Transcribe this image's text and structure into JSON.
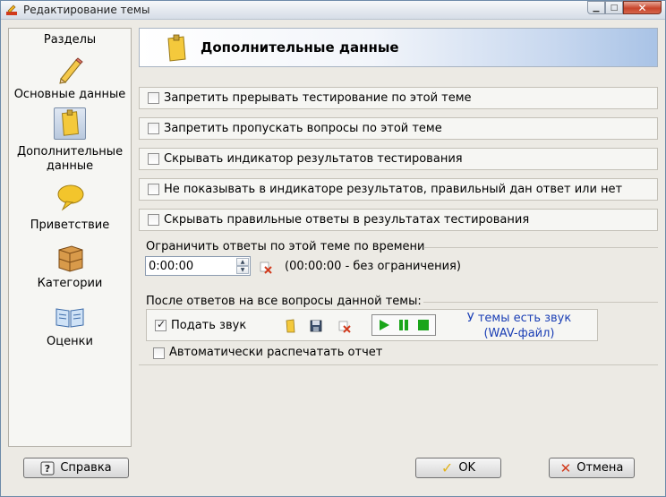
{
  "window": {
    "title": "Редактирование темы",
    "icons": {
      "app": "pencil-icon",
      "minimize": "minimize-icon",
      "maximize": "maximize-icon",
      "close": "close-icon"
    }
  },
  "sidebar": {
    "caption": "Разделы",
    "items": [
      {
        "label": "Основные данные",
        "icon": "pencil-icon",
        "selected": false
      },
      {
        "label": "Дополнительные данные",
        "icon": "sticky-note-icon",
        "selected": true
      },
      {
        "label": "Приветствие",
        "icon": "speech-bubble-icon",
        "selected": false
      },
      {
        "label": "Категории",
        "icon": "cabinet-icon",
        "selected": false
      },
      {
        "label": "Оценки",
        "icon": "book-icon",
        "selected": false
      }
    ]
  },
  "header": {
    "title": "Дополнительные данные",
    "icon": "sticky-note-icon"
  },
  "options": [
    {
      "label": "Запретить прерывать тестирование по этой теме",
      "checked": false
    },
    {
      "label": "Запретить пропускать вопросы по этой теме",
      "checked": false
    },
    {
      "label": "Скрывать индикатор результатов тестирования",
      "checked": false
    },
    {
      "label": "Не показывать в индикаторе результатов, правильный дан ответ или нет",
      "checked": false
    },
    {
      "label": "Скрывать правильные ответы в результатах тестирования",
      "checked": false
    }
  ],
  "time_limit": {
    "label": "Ограничить ответы по этой теме по времени",
    "value": "0:00:00",
    "note": "(00:00:00 - без ограничения)"
  },
  "after_answers": {
    "label": "После ответов на все вопросы данной темы:",
    "play_sound": {
      "label": "Подать звук",
      "checked": true
    },
    "sound_status_line1": "У темы есть звук",
    "sound_status_line2": "(WAV-файл)",
    "auto_print": {
      "label": "Автоматически распечатать отчет",
      "checked": false
    }
  },
  "footer": {
    "help_label": "Справка",
    "ok_label": "OK",
    "cancel_label": "Отмена"
  },
  "colors": {
    "accent_blue": "#1b3fb5",
    "play_green": "#1aa51a",
    "cancel_red": "#d23a1c",
    "ok_yellow": "#e2b21a"
  }
}
